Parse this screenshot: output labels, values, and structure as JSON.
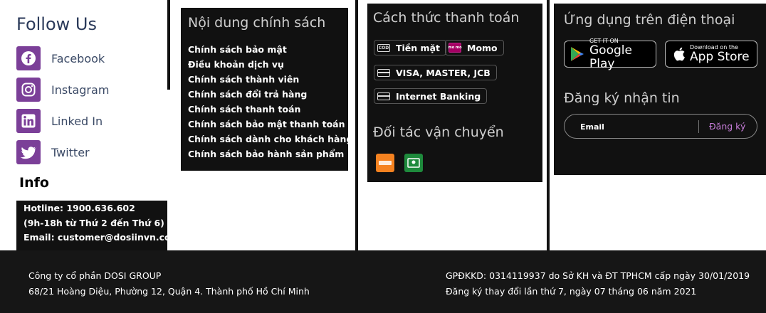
{
  "follow": {
    "title": "Follow Us",
    "items": [
      {
        "label": "Facebook",
        "icon": "facebook-icon"
      },
      {
        "label": "Instagram",
        "icon": "instagram-icon"
      },
      {
        "label": "Linked In",
        "icon": "linkedin-icon"
      },
      {
        "label": "Twitter",
        "icon": "twitter-icon"
      }
    ],
    "icon_color": "#7b3f98"
  },
  "info": {
    "title": "Info",
    "lines": [
      "Hotline: 1900.636.602",
      "(9h-18h từ Thứ 2 đến Thứ 6)",
      "Email: customer@dosiinvn.com"
    ]
  },
  "policy": {
    "title": "Nội dung chính sách",
    "links": [
      "Chính sách bảo mật",
      "Điều khoản dịch vụ",
      "Chính sách thành viên",
      "Chính sách đổi trả hàng",
      "Chính sách thanh toán",
      "Chính sách bảo mật thanh toán",
      "Chính sách dành cho khách hàng",
      "Chính sách bảo hành sản phẩm"
    ]
  },
  "payment": {
    "title": "Cách thức thanh toán",
    "methods": [
      {
        "label": "Tiền mặt",
        "icon": "cash-cod-icon",
        "badge": "COD"
      },
      {
        "label": "Momo",
        "icon": "momo-icon",
        "badge": "mo mo"
      },
      {
        "label": "VISA, MASTER, JCB",
        "icon": "credit-card-icon"
      },
      {
        "label": "Internet Banking",
        "icon": "bank-card-icon"
      }
    ],
    "momo_color": "#a50064"
  },
  "shipping": {
    "title": "Đối tác vận chuyển",
    "partners": [
      {
        "icon": "shipping-partner-orange-icon",
        "color": "#f58220"
      },
      {
        "icon": "shipping-partner-green-icon",
        "color": "#1e8a3c"
      }
    ]
  },
  "app": {
    "title": "Ứng dụng trên điện thoại",
    "google_play": {
      "small": "GET IT ON",
      "big": "Google Play"
    },
    "app_store": {
      "small": "Download on the",
      "big": "App Store"
    }
  },
  "newsletter": {
    "title": "Đăng ký nhận tin",
    "placeholder": "Email",
    "button": "Đăng ký",
    "button_color": "#c77dd9"
  },
  "footer": {
    "company": "Công ty cổ phần DOSI GROUP",
    "address": "68/21 Hoàng Diệu, Phường 12, Quận 4. Thành phố Hồ Chí Minh",
    "license": "GPĐKKD: 0314119937 do Sở KH và ĐT TPHCM cấp ngày 30/01/2019",
    "change": "Đăng ký thay đổi lần thứ 7, ngày 07 tháng 06 năm 2021"
  }
}
